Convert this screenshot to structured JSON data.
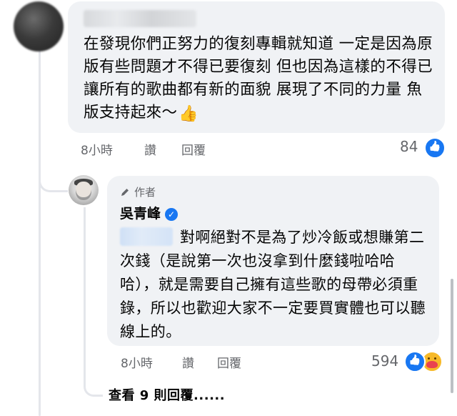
{
  "comment": {
    "text": "在發現你們正努力的復刻專輯就知道 一定是因為原版有些問題才不得已要復刻 但也因為這樣的不得已讓所有的歌曲都有新的面貌 展現了不同的力量 魚版支持起來～",
    "emoji": "👍",
    "time": "8小時",
    "like_label": "讚",
    "reply_label": "回覆",
    "reaction_count": "84",
    "reaction_icon": "like-icon"
  },
  "reply": {
    "author_badge": "作者",
    "author_name": "吳青峰",
    "verified_icon": "verified-badge-icon",
    "text": "對啊絕對不是為了炒冷飯或想賺第二次錢（是說第一次也沒拿到什麼錢啦哈哈哈），就是需要自己擁有這些歌的母帶必須重錄，所以也歡迎大家不一定要買實體也可以聽線上的。",
    "time": "8小時",
    "like_label": "讚",
    "reply_label": "回覆",
    "reaction_count": "594",
    "reaction_icons": [
      "like-icon",
      "care-icon"
    ]
  },
  "view_more_replies": "查看 9 則回覆......",
  "colors": {
    "bubble_bg": "#f0f2f5",
    "meta_text": "#65676b",
    "accent_blue": "#1877f2",
    "text_primary": "#050505"
  }
}
